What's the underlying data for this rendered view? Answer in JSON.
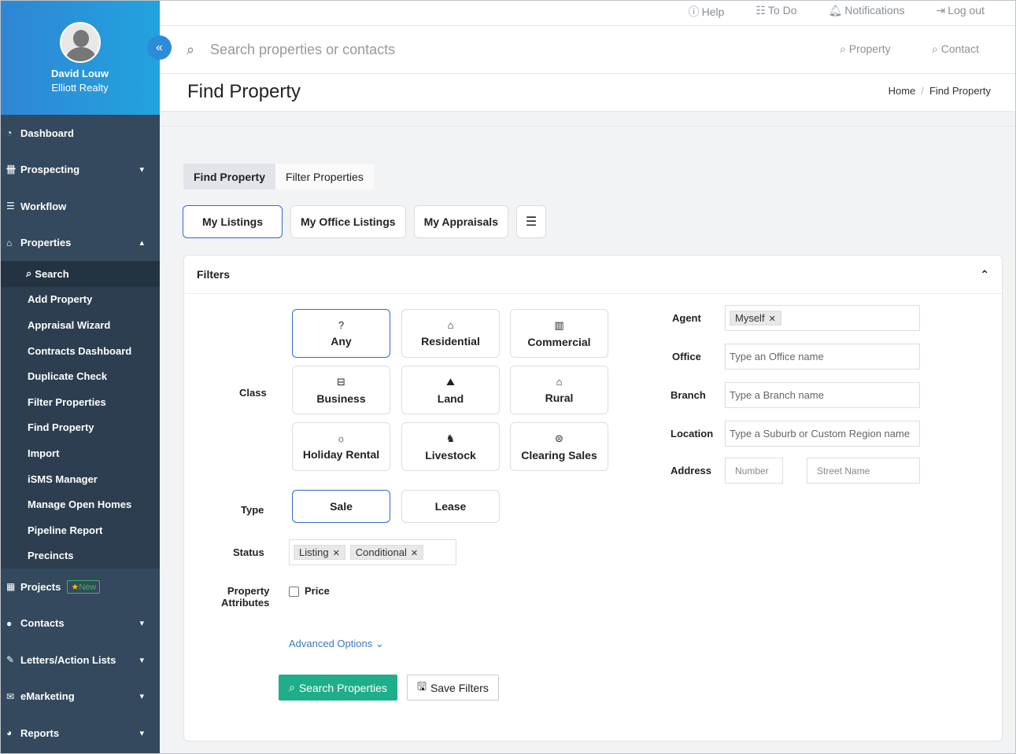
{
  "user": {
    "name": "David Louw",
    "company": "Elliott Realty"
  },
  "nav": {
    "dashboard": "Dashboard",
    "prospecting": "Prospecting",
    "workflow": "Workflow",
    "properties": "Properties",
    "property_sub": [
      "Search",
      "Add Property",
      "Appraisal Wizard",
      "Contracts Dashboard",
      "Duplicate Check",
      "Filter Properties",
      "Find Property",
      "Import",
      "iSMS Manager",
      "Manage Open Homes",
      "Pipeline Report",
      "Precincts"
    ],
    "projects": "Projects",
    "projects_badge": "New",
    "contacts": "Contacts",
    "letters": "Letters/Action Lists",
    "emarketing": "eMarketing",
    "reports": "Reports"
  },
  "top": {
    "help": "Help",
    "todo": "To Do",
    "notifications": "Notifications",
    "logout": "Log out"
  },
  "search": {
    "placeholder": "Search properties or contacts",
    "property": "Property",
    "contact": "Contact"
  },
  "page": {
    "title": "Find Property",
    "crumb_home": "Home",
    "crumb_current": "Find Property"
  },
  "tabs": {
    "find": "Find Property",
    "filter": "Filter Properties"
  },
  "listing_buttons": {
    "my_listings": "My Listings",
    "my_office": "My Office Listings",
    "my_appraisals": "My Appraisals"
  },
  "filters": {
    "title": "Filters",
    "class_label": "Class",
    "classes": [
      "Any",
      "Residential",
      "Commercial",
      "Business",
      "Land",
      "Rural",
      "Holiday Rental",
      "Livestock",
      "Clearing Sales"
    ],
    "type_label": "Type",
    "types": [
      "Sale",
      "Lease"
    ],
    "status_label": "Status",
    "status_tags": [
      "Listing",
      "Conditional"
    ],
    "attributes_label_1": "Property",
    "attributes_label_2": "Attributes",
    "price_label": "Price",
    "advanced": "Advanced Options",
    "search_btn": "Search Properties",
    "save_btn": "Save Filters",
    "agent_label": "Agent",
    "agent_tag": "Myself",
    "office_label": "Office",
    "office_placeholder": "Type an Office name",
    "branch_label": "Branch",
    "branch_placeholder": "Type a Branch name",
    "location_label": "Location",
    "location_placeholder": "Type a Suburb or Custom Region name",
    "address_label": "Address",
    "number_placeholder": "Number",
    "street_placeholder": "Street Name"
  }
}
